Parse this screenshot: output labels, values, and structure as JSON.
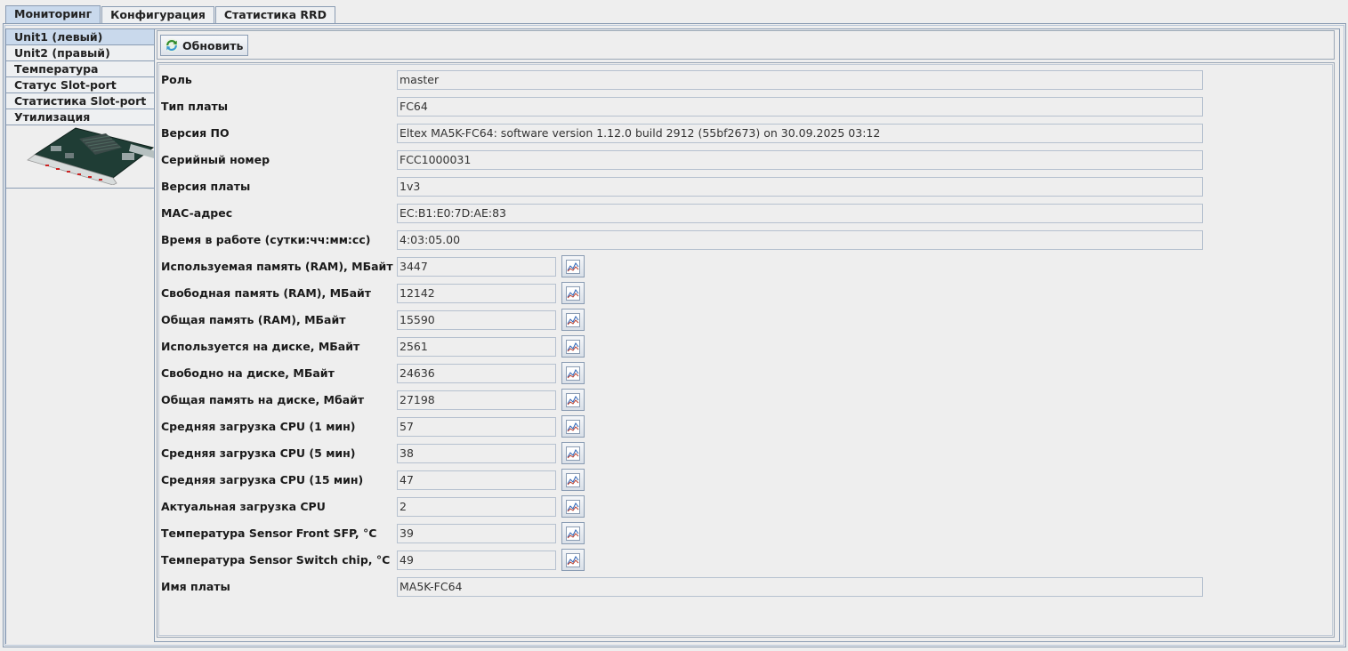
{
  "top_tabs": [
    "Мониторинг",
    "Конфигурация",
    "Статистика RRD"
  ],
  "side_tabs": [
    "Unit1 (левый)",
    "Unit2 (правый)",
    "Температура",
    "Статус Slot-port",
    "Статистика Slot-port",
    "Утилизация"
  ],
  "toolbar": {
    "refresh_label": "Обновить"
  },
  "fields": [
    {
      "label": "Роль",
      "value": "master"
    },
    {
      "label": "Тип платы",
      "value": "FC64"
    },
    {
      "label": "Версия ПО",
      "value": "Eltex MA5K-FC64: software version 1.12.0 build 2912 (55bf2673) on 30.09.2025 03:12"
    },
    {
      "label": "Серийный номер",
      "value": "FCC1000031"
    },
    {
      "label": "Версия платы",
      "value": "1v3"
    },
    {
      "label": "MAC-адрес",
      "value": "EC:B1:E0:7D:AE:83"
    },
    {
      "label": "Время в работе (сутки:чч:мм:сс)",
      "value": "4:03:05.00"
    },
    {
      "label": "Используемая память (RAM), МБайт",
      "value": "3447"
    },
    {
      "label": "Свободная память (RAM), МБайт",
      "value": "12142"
    },
    {
      "label": "Общая память (RAM), МБайт",
      "value": "15590"
    },
    {
      "label": "Используется на диске, МБайт",
      "value": "2561"
    },
    {
      "label": "Свободно на диске, МБайт",
      "value": "24636"
    },
    {
      "label": "Общая память на диске, Мбайт",
      "value": "27198"
    },
    {
      "label": "Средняя загрузка CPU (1 мин)",
      "value": "57"
    },
    {
      "label": "Средняя загрузка CPU (5 мин)",
      "value": "38"
    },
    {
      "label": "Средняя загрузка CPU (15 мин)",
      "value": "47"
    },
    {
      "label": "Актуальная загрузка CPU",
      "value": "2"
    },
    {
      "label": "Температура Sensor Front SFP, °C",
      "value": "39"
    },
    {
      "label": "Температура Sensor Switch chip, °C",
      "value": "49"
    },
    {
      "label": "Имя платы",
      "value": "MA5K-FC64"
    }
  ]
}
